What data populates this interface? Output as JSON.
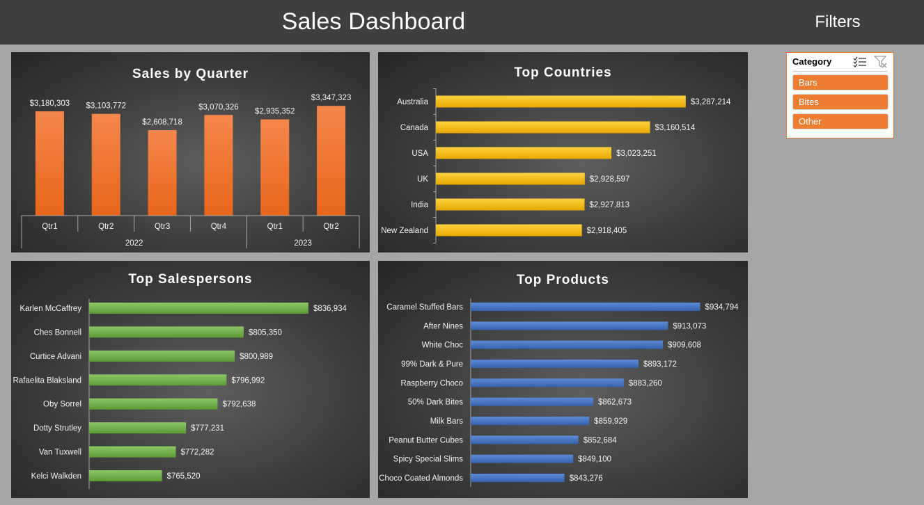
{
  "header": {
    "title": "Sales Dashboard",
    "filters_title": "Filters"
  },
  "colors": {
    "quarter": "#ed7d31",
    "country": "#ffc000",
    "salesperson": "#70ad47",
    "product": "#4472c4",
    "slicer_item": "#ed7d31"
  },
  "charts": {
    "quarter": {
      "title": "Sales by Quarter"
    },
    "countries": {
      "title": "Top Countries"
    },
    "salespersons": {
      "title": "Top Salespersons"
    },
    "products": {
      "title": "Top Products"
    }
  },
  "slicer": {
    "header": "Category",
    "icons": [
      "multi-select-icon",
      "clear-filter-icon"
    ],
    "items": [
      "Bars",
      "Bites",
      "Other"
    ]
  },
  "chart_data": [
    {
      "type": "bar",
      "title": "Sales by Quarter",
      "categories": [
        "Qtr1",
        "Qtr2",
        "Qtr3",
        "Qtr4",
        "Qtr1",
        "Qtr2"
      ],
      "groups": [
        {
          "label": "2022",
          "count": 4
        },
        {
          "label": "2023",
          "count": 2
        }
      ],
      "values": [
        3180303,
        3103772,
        2608718,
        3070326,
        2935352,
        3347323
      ],
      "labels": [
        "$3,180,303",
        "$3,103,772",
        "$2,608,718",
        "$3,070,326",
        "$2,935,352",
        "$3,347,323"
      ],
      "ylim": [
        0,
        3500000
      ]
    },
    {
      "type": "bar",
      "orientation": "horizontal",
      "title": "Top Countries",
      "categories": [
        "Australia",
        "Canada",
        "USA",
        "UK",
        "India",
        "New Zealand"
      ],
      "values": [
        3287214,
        3160514,
        3023251,
        2928597,
        2927813,
        2918405
      ],
      "labels": [
        "$3,287,214",
        "$3,160,514",
        "$3,023,251",
        "$2,928,597",
        "$2,927,813",
        "$2,918,405"
      ],
      "xlim": [
        2400000,
        3300000
      ]
    },
    {
      "type": "bar",
      "orientation": "horizontal",
      "title": "Top Salespersons",
      "categories": [
        "Karlen McCaffrey",
        "Ches Bonnell",
        "Curtice Advani",
        "Rafaelita Blaksland",
        "Oby Sorrel",
        "Dotty Strutley",
        "Van Tuxwell",
        "Kelci Walkden"
      ],
      "values": [
        836934,
        805350,
        800989,
        796992,
        792638,
        777231,
        772282,
        765520
      ],
      "labels": [
        "$836,934",
        "$805,350",
        "$800,989",
        "$796,992",
        "$792,638",
        "$777,231",
        "$772,282",
        "$765,520"
      ],
      "xlim": [
        730000,
        840000
      ]
    },
    {
      "type": "bar",
      "orientation": "horizontal",
      "title": "Top Products",
      "categories": [
        "Caramel Stuffed Bars",
        "After Nines",
        "White Choc",
        "99% Dark & Pure",
        "Raspberry Choco",
        "50% Dark Bites",
        "Milk Bars",
        "Peanut Butter Cubes",
        "Spicy Special Slims",
        "Choco Coated Almonds"
      ],
      "values": [
        934794,
        913073,
        909608,
        893172,
        883260,
        862673,
        859929,
        852684,
        849100,
        843276
      ],
      "labels": [
        "$934,794",
        "$913,073",
        "$909,608",
        "$893,172",
        "$883,260",
        "$862,673",
        "$859,929",
        "$852,684",
        "$849,100",
        "$843,276"
      ],
      "xlim": [
        780000,
        935000
      ]
    }
  ]
}
